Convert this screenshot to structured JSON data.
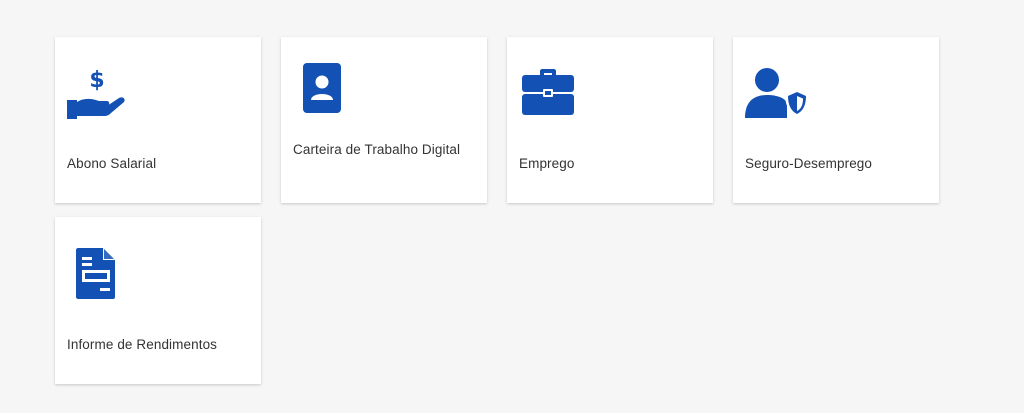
{
  "theme": {
    "icon_color": "#1351b4",
    "card_bg": "#ffffff",
    "page_bg": "#f6f6f6",
    "text_color": "#333333"
  },
  "cards": [
    {
      "label": "Abono Salarial",
      "icon": "hand-dollar-icon"
    },
    {
      "label": "Carteira de Trabalho Digital",
      "icon": "id-card-icon"
    },
    {
      "label": "Emprego",
      "icon": "briefcase-icon"
    },
    {
      "label": "Seguro-Desemprego",
      "icon": "user-shield-icon"
    },
    {
      "label": "Informe de Rendimentos",
      "icon": "document-icon"
    }
  ]
}
